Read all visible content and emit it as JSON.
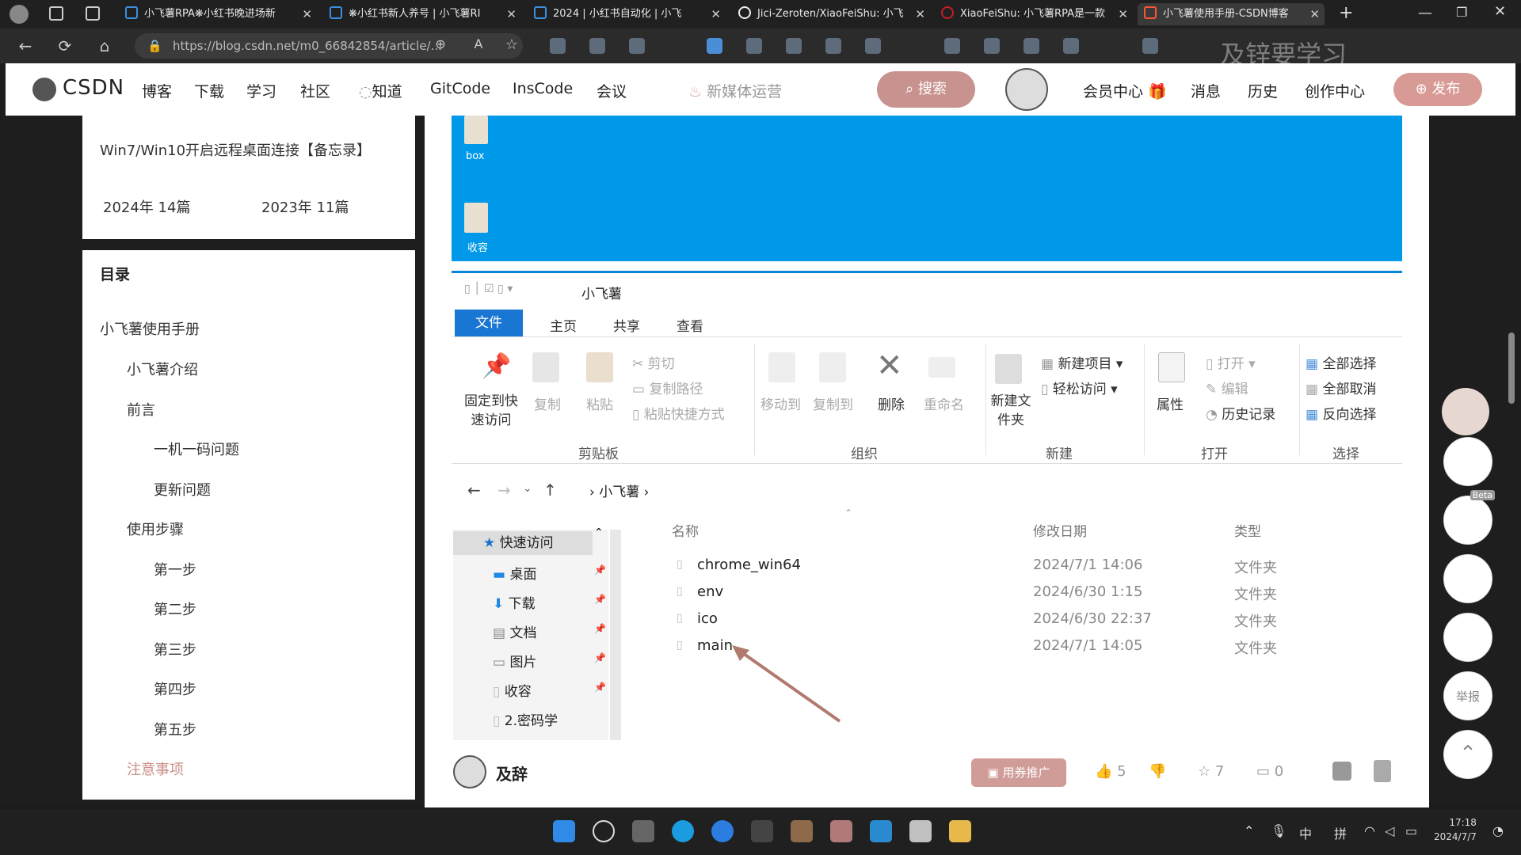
{
  "browser": {
    "tabs": [
      {
        "title": "小飞薯RPA❋小红书晚进场新"
      },
      {
        "title": "❋小红书新人养号 | 小飞薯RI"
      },
      {
        "title": "2024 | 小红书自动化 | 小飞"
      },
      {
        "title": "Jici-Zeroten/XiaoFeiShu: 小飞"
      },
      {
        "title": "XiaoFeiShu: 小飞薯RPA是一款"
      },
      {
        "title": "小飞薯使用手册-CSDN博客"
      }
    ],
    "url": "https://blog.csdn.net/m0_66842854/article/...",
    "watermark": "及锌要学习"
  },
  "csdn": {
    "logo": "CSDN",
    "nav": [
      "博客",
      "下载",
      "学习",
      "社区",
      "知道",
      "GitCode",
      "InsCode",
      "会议"
    ],
    "hot": "新媒体运营",
    "search_label": "搜索",
    "right_nav": [
      "会员中心",
      "消息",
      "历史",
      "创作中心"
    ],
    "publish_label": "发布"
  },
  "sidebar": {
    "recent_article": "Win7/Win10开启远程桌面连接【备忘录】",
    "archives": [
      {
        "year": "2024年",
        "count": "14篇"
      },
      {
        "year": "2023年",
        "count": "11篇"
      }
    ],
    "toc_title": "目录",
    "toc": [
      {
        "label": "小飞薯使用手册",
        "level": 0
      },
      {
        "label": "小飞薯介绍",
        "level": 1
      },
      {
        "label": "前言",
        "level": 1
      },
      {
        "label": "一机一码问题",
        "level": 2
      },
      {
        "label": "更新问题",
        "level": 2
      },
      {
        "label": "使用步骤",
        "level": 1
      },
      {
        "label": "第一步",
        "level": 2
      },
      {
        "label": "第二步",
        "level": 2
      },
      {
        "label": "第三步",
        "level": 2
      },
      {
        "label": "第四步",
        "level": 2
      },
      {
        "label": "第五步",
        "level": 2
      },
      {
        "label": "注意事项",
        "level": 1
      }
    ]
  },
  "desktop": {
    "icons": [
      "box",
      "收容"
    ]
  },
  "explorer": {
    "title": "小飞薯",
    "ribbon_tabs": [
      "文件",
      "主页",
      "共享",
      "查看"
    ],
    "clipboard": {
      "pin": "固定到快速访问",
      "copy": "复制",
      "paste": "粘贴",
      "cut": "剪切",
      "copy_path": "复制路径",
      "paste_shortcut": "粘贴快捷方式",
      "group": "剪贴板"
    },
    "organize": {
      "move_to": "移动到",
      "copy_to": "复制到",
      "delete": "删除",
      "rename": "重命名",
      "group": "组织"
    },
    "new": {
      "new_folder": "新建文件夹",
      "new_item": "新建项目",
      "easy_access": "轻松访问",
      "group": "新建"
    },
    "open": {
      "properties": "属性",
      "open": "打开",
      "edit": "编辑",
      "history": "历史记录",
      "group": "打开"
    },
    "select": {
      "select_all": "全部选择",
      "select_none": "全部取消",
      "invert": "反向选择",
      "group": "选择"
    },
    "breadcrumb": "小飞薯",
    "nav_pane": [
      {
        "label": "快速访问"
      },
      {
        "label": "桌面"
      },
      {
        "label": "下载"
      },
      {
        "label": "文档"
      },
      {
        "label": "图片"
      },
      {
        "label": "收容"
      },
      {
        "label": "2.密码学"
      }
    ],
    "columns": {
      "name": "名称",
      "date": "修改日期",
      "type": "类型"
    },
    "files": [
      {
        "name": "chrome_win64",
        "date": "2024/7/1 14:06",
        "type": "文件夹"
      },
      {
        "name": "env",
        "date": "2024/6/30 1:15",
        "type": "文件夹"
      },
      {
        "name": "ico",
        "date": "2024/6/30 22:37",
        "type": "文件夹"
      },
      {
        "name": "main",
        "date": "2024/7/1 14:05",
        "type": "文件夹"
      }
    ]
  },
  "article_footer": {
    "author": "及辞",
    "promo": "用券推广",
    "likes": "5",
    "favorites": "7",
    "comments": "0"
  },
  "float": {
    "beta": "Beta",
    "report": "举报"
  },
  "taskbar": {
    "ime1": "中",
    "ime2": "拼",
    "time": "17:18",
    "date": "2024/7/7"
  },
  "colors": {
    "csdn_red": "#c8928e",
    "desktop_blue": "#0098e8",
    "explorer_accent": "#0a84d8"
  }
}
